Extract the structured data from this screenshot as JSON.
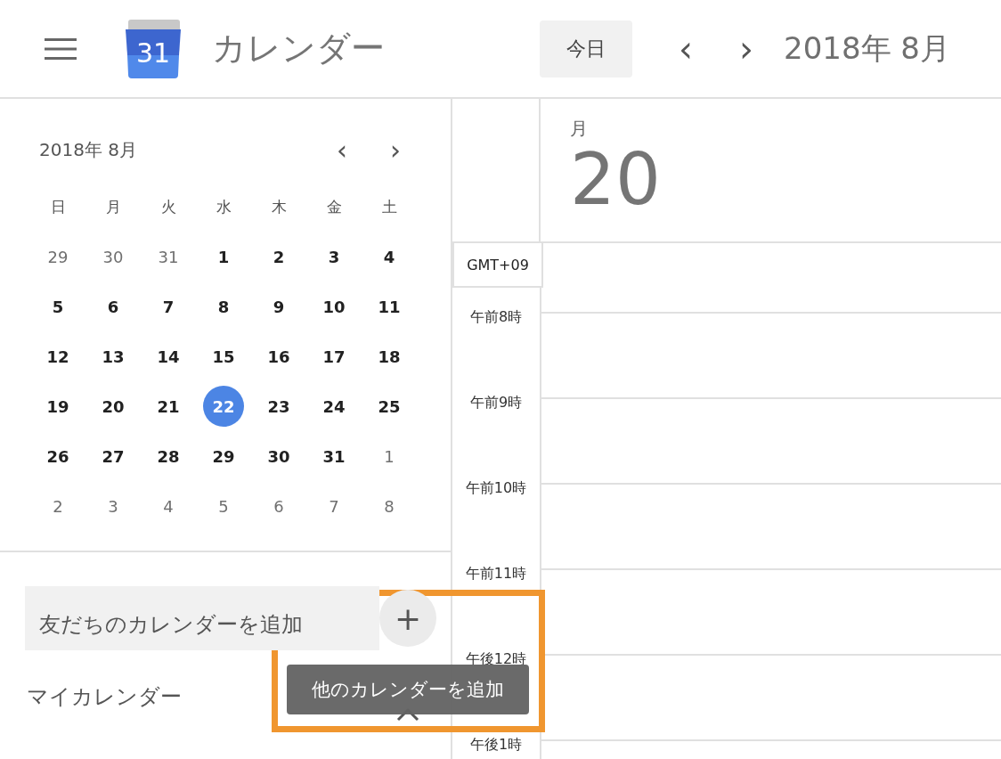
{
  "header": {
    "app_title": "カレンダー",
    "logo_day": "31",
    "today_button": "今日",
    "prev": "‹",
    "next": "›",
    "period": "2018年 8月"
  },
  "mini_calendar": {
    "month": "2018年 8月",
    "weekdays": [
      "日",
      "月",
      "火",
      "水",
      "木",
      "金",
      "土"
    ],
    "weeks": [
      [
        {
          "d": "29",
          "muted": true,
          "selected": false
        },
        {
          "d": "30",
          "muted": true,
          "selected": false
        },
        {
          "d": "31",
          "muted": true,
          "selected": false
        },
        {
          "d": "1",
          "muted": false,
          "selected": false
        },
        {
          "d": "2",
          "muted": false,
          "selected": false
        },
        {
          "d": "3",
          "muted": false,
          "selected": false
        },
        {
          "d": "4",
          "muted": false,
          "selected": false
        }
      ],
      [
        {
          "d": "5",
          "muted": false,
          "selected": false
        },
        {
          "d": "6",
          "muted": false,
          "selected": false
        },
        {
          "d": "7",
          "muted": false,
          "selected": false
        },
        {
          "d": "8",
          "muted": false,
          "selected": false
        },
        {
          "d": "9",
          "muted": false,
          "selected": false
        },
        {
          "d": "10",
          "muted": false,
          "selected": false
        },
        {
          "d": "11",
          "muted": false,
          "selected": false
        }
      ],
      [
        {
          "d": "12",
          "muted": false,
          "selected": false
        },
        {
          "d": "13",
          "muted": false,
          "selected": false
        },
        {
          "d": "14",
          "muted": false,
          "selected": false
        },
        {
          "d": "15",
          "muted": false,
          "selected": false
        },
        {
          "d": "16",
          "muted": false,
          "selected": false
        },
        {
          "d": "17",
          "muted": false,
          "selected": false
        },
        {
          "d": "18",
          "muted": false,
          "selected": false
        }
      ],
      [
        {
          "d": "19",
          "muted": false,
          "selected": false
        },
        {
          "d": "20",
          "muted": false,
          "selected": false
        },
        {
          "d": "21",
          "muted": false,
          "selected": false
        },
        {
          "d": "22",
          "muted": false,
          "selected": true
        },
        {
          "d": "23",
          "muted": false,
          "selected": false
        },
        {
          "d": "24",
          "muted": false,
          "selected": false
        },
        {
          "d": "25",
          "muted": false,
          "selected": false
        }
      ],
      [
        {
          "d": "26",
          "muted": false,
          "selected": false
        },
        {
          "d": "27",
          "muted": false,
          "selected": false
        },
        {
          "d": "28",
          "muted": false,
          "selected": false
        },
        {
          "d": "29",
          "muted": false,
          "selected": false
        },
        {
          "d": "30",
          "muted": false,
          "selected": false
        },
        {
          "d": "31",
          "muted": false,
          "selected": false
        },
        {
          "d": "1",
          "muted": true,
          "selected": false
        }
      ],
      [
        {
          "d": "2",
          "muted": true,
          "selected": false
        },
        {
          "d": "3",
          "muted": true,
          "selected": false
        },
        {
          "d": "4",
          "muted": true,
          "selected": false
        },
        {
          "d": "5",
          "muted": true,
          "selected": false
        },
        {
          "d": "6",
          "muted": true,
          "selected": false
        },
        {
          "d": "7",
          "muted": true,
          "selected": false
        },
        {
          "d": "8",
          "muted": true,
          "selected": false
        }
      ]
    ]
  },
  "add_friend_calendar": {
    "placeholder": "友だちのカレンダーを追加"
  },
  "add_button": "+",
  "tooltip": "他のカレンダーを追加",
  "my_calendars": "マイカレンダー",
  "day_view": {
    "weekday": "月",
    "day": "20",
    "timezone": "GMT+09",
    "hours": [
      "午前8時",
      "午前9時",
      "午前10時",
      "午前11時",
      "午後12時",
      "午後1時"
    ]
  }
}
